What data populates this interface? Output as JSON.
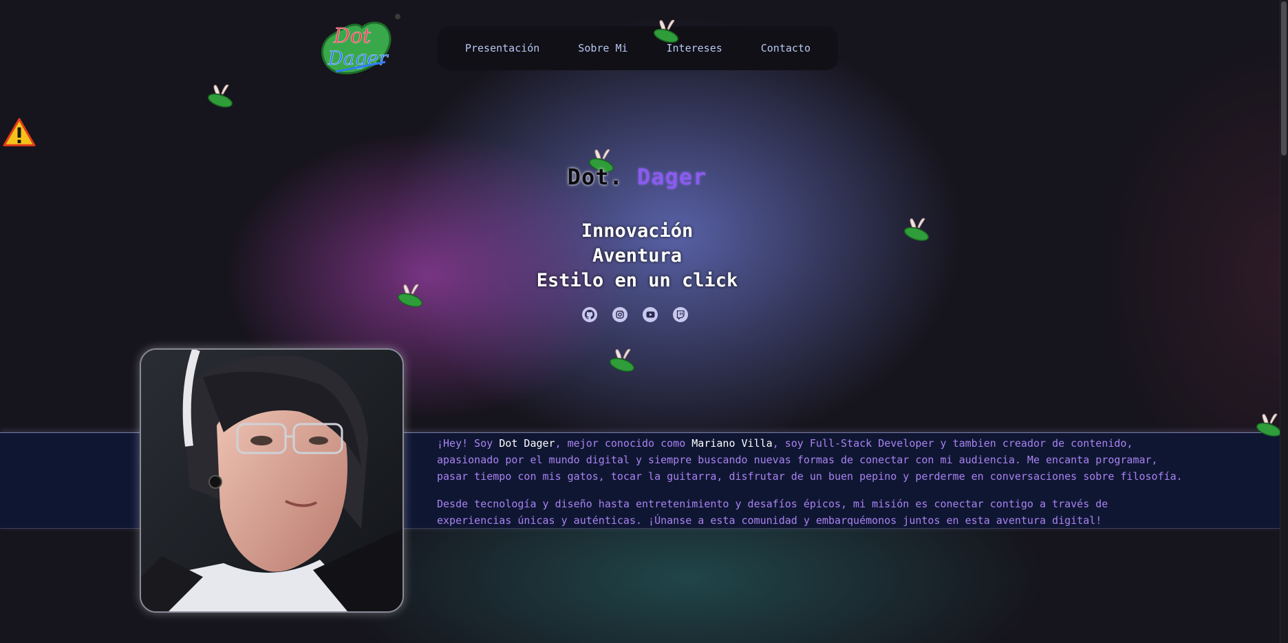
{
  "logo": {
    "line1": "Dot",
    "line2": "Dager"
  },
  "nav": {
    "items": [
      {
        "label": "Presentación"
      },
      {
        "label": "Sobre Mi"
      },
      {
        "label": "Intereses"
      },
      {
        "label": "Contacto"
      }
    ]
  },
  "hero": {
    "title_part1": "Dot.",
    "title_part2": "Dager",
    "tagline": [
      "Innovación",
      "Aventura",
      "Estilo en un click"
    ]
  },
  "socials": [
    {
      "icon": "github-icon"
    },
    {
      "icon": "instagram-icon"
    },
    {
      "icon": "youtube-icon"
    },
    {
      "icon": "twitch-icon"
    }
  ],
  "about": {
    "p1_a": "¡Hey! Soy ",
    "p1_name": "Dot Dager",
    "p1_b": ", mejor conocido como ",
    "p1_real": "Mariano Villa",
    "p1_c": ", soy Full-Stack Developer y tambien creador de contenido, apasionado por el mundo digital y siempre buscando nuevas formas de conectar con mi audiencia. Me encanta programar, pasar tiempo con mis gatos, tocar la guitarra, disfrutar de un buen pepino y perderme en conversaciones sobre filosofía.",
    "p2": "Desde tecnología y diseño hasta entretenimiento y desafíos épicos, mi misión es conectar contigo a través de experiencias únicas y auténticas. ¡Únanse a esta comunidad y embarquémonos juntos en esta aventura digital!"
  },
  "colors": {
    "accent_purple": "#8a5bf0",
    "text_purple": "#a983f2",
    "nav_text": "#b8c8f4",
    "band_bg": "#0f1632"
  }
}
